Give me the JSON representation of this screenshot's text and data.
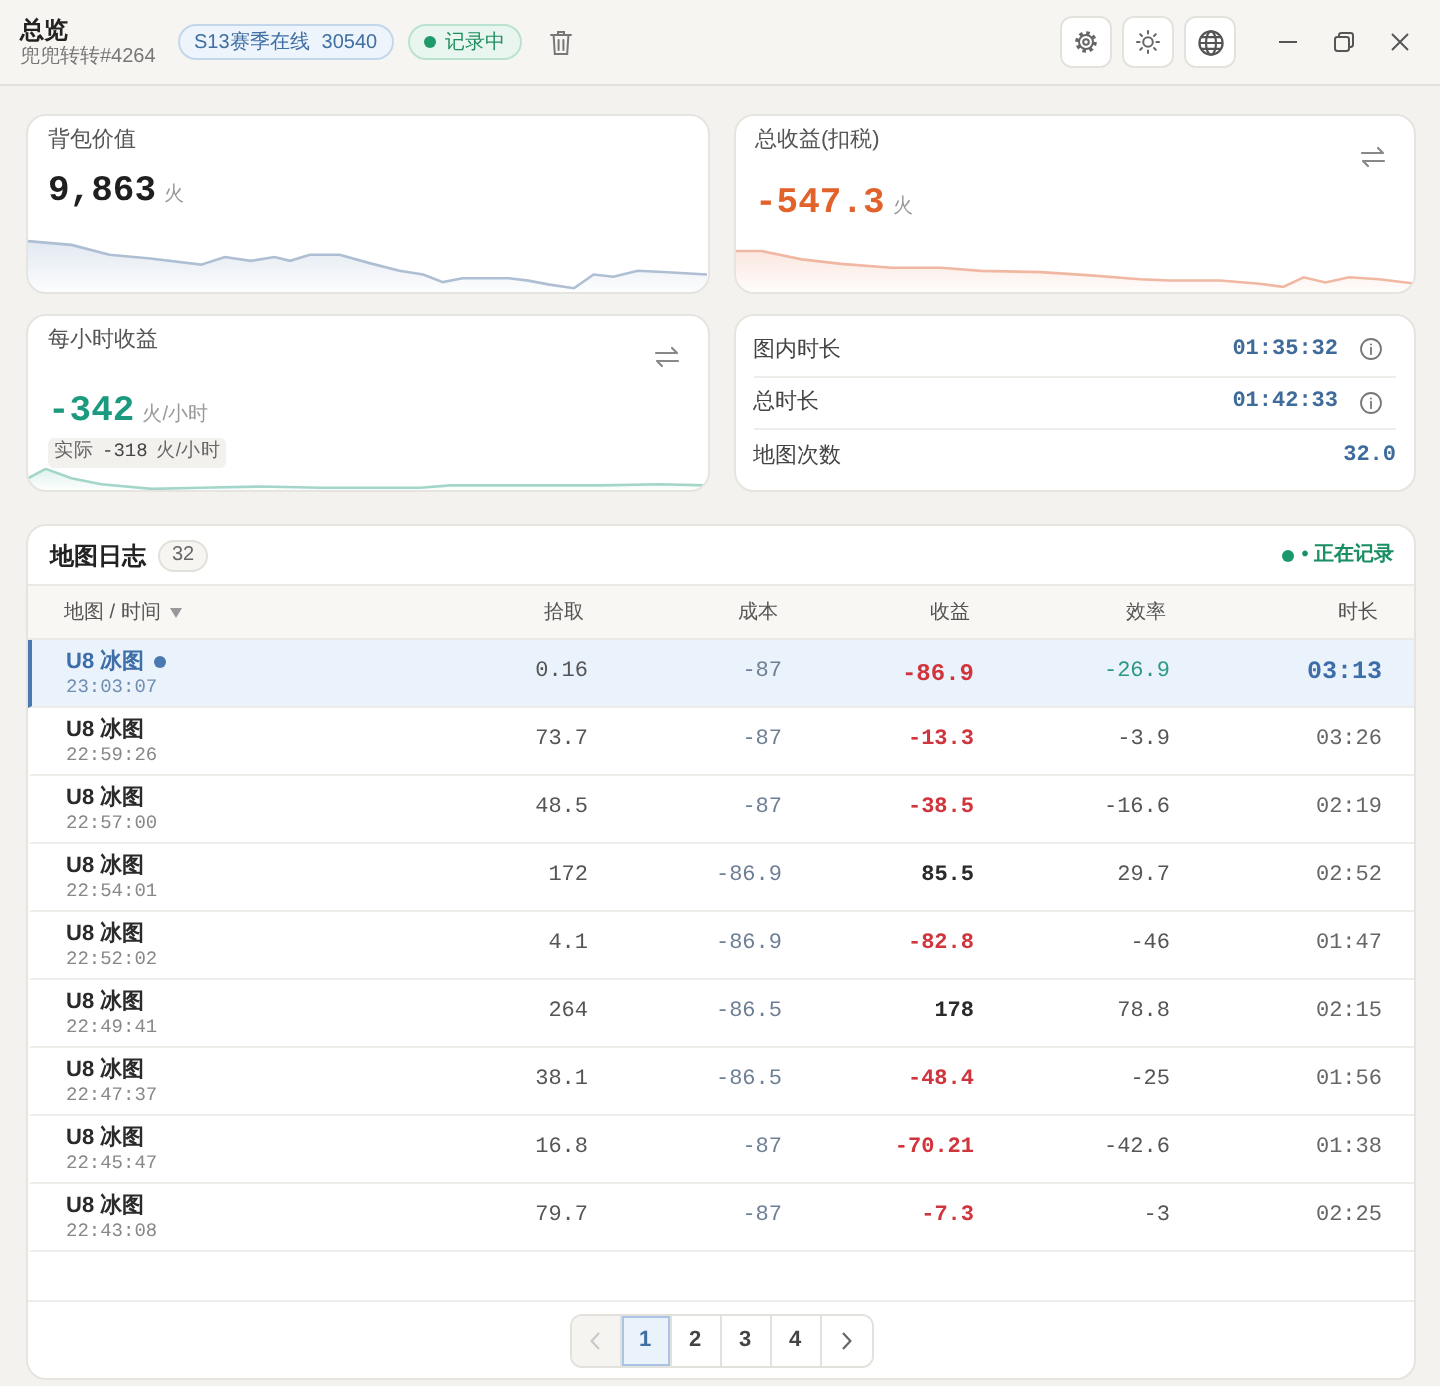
{
  "window": {
    "title": "总览",
    "subtitle": "兜兜转转#4264"
  },
  "season_badge": {
    "label": "S13赛季在线",
    "count": "30540"
  },
  "recording_badge": {
    "label": "记录中"
  },
  "stat_cards": [
    {
      "label": "背包价值",
      "value": "9,863",
      "unit": "火",
      "color": "#1f1f1f",
      "swap": false
    },
    {
      "label": "总收益(扣税)",
      "value": "-547.3",
      "unit": "火",
      "color": "#e2622c",
      "swap": true
    },
    {
      "label": "每小时收益",
      "value": "-342",
      "unit": "火/小时",
      "color": "#1b9a7f",
      "swap": true,
      "actual": {
        "label": "实际",
        "value": "-318",
        "unit": "火/小时"
      }
    }
  ],
  "durations": [
    {
      "label": "图内时长",
      "value": "01:35:32",
      "info": true
    },
    {
      "label": "总时长",
      "value": "01:42:33",
      "info": true
    },
    {
      "label": "地图次数",
      "value": "32.0",
      "info": false
    }
  ],
  "map_log": {
    "title": "地图日志",
    "count": "32",
    "status": "• 正在记录",
    "columns": [
      {
        "label": "地图 / 时间",
        "sorted": true
      },
      {
        "label": "拾取",
        "sorted": false
      },
      {
        "label": "成本",
        "sorted": false
      },
      {
        "label": "收益",
        "sorted": false
      },
      {
        "label": "效率",
        "sorted": false
      },
      {
        "label": "时长",
        "sorted": false
      }
    ],
    "rows": [
      {
        "map": "U8 冰图",
        "time": "23:03:07",
        "pickup": "0.16",
        "cost": "-87",
        "profit": "-86.9",
        "loss": true,
        "efficiency": "-26.9",
        "duration": "03:13",
        "selected": true,
        "live": true
      },
      {
        "map": "U8 冰图",
        "time": "22:59:26",
        "pickup": "73.7",
        "cost": "-87",
        "profit": "-13.3",
        "loss": true,
        "efficiency": "-3.9",
        "duration": "03:26",
        "selected": false,
        "live": false
      },
      {
        "map": "U8 冰图",
        "time": "22:57:00",
        "pickup": "48.5",
        "cost": "-87",
        "profit": "-38.5",
        "loss": true,
        "efficiency": "-16.6",
        "duration": "02:19",
        "selected": false,
        "live": false
      },
      {
        "map": "U8 冰图",
        "time": "22:54:01",
        "pickup": "172",
        "cost": "-86.9",
        "profit": "85.5",
        "loss": false,
        "efficiency": "29.7",
        "duration": "02:52",
        "selected": false,
        "live": false
      },
      {
        "map": "U8 冰图",
        "time": "22:52:02",
        "pickup": "4.1",
        "cost": "-86.9",
        "profit": "-82.8",
        "loss": true,
        "efficiency": "-46",
        "duration": "01:47",
        "selected": false,
        "live": false
      },
      {
        "map": "U8 冰图",
        "time": "22:49:41",
        "pickup": "264",
        "cost": "-86.5",
        "profit": "178",
        "loss": false,
        "efficiency": "78.8",
        "duration": "02:15",
        "selected": false,
        "live": false
      },
      {
        "map": "U8 冰图",
        "time": "22:47:37",
        "pickup": "38.1",
        "cost": "-86.5",
        "profit": "-48.4",
        "loss": true,
        "efficiency": "-25",
        "duration": "01:56",
        "selected": false,
        "live": false
      },
      {
        "map": "U8 冰图",
        "time": "22:45:47",
        "pickup": "16.8",
        "cost": "-87",
        "profit": "-70.21",
        "loss": true,
        "efficiency": "-42.6",
        "duration": "01:38",
        "selected": false,
        "live": false
      },
      {
        "map": "U8 冰图",
        "time": "22:43:08",
        "pickup": "79.7",
        "cost": "-87",
        "profit": "-7.3",
        "loss": true,
        "efficiency": "-3",
        "duration": "02:25",
        "selected": false,
        "live": false
      }
    ],
    "pagination": {
      "prev_disabled": true,
      "next_disabled": false,
      "pages": [
        {
          "label": "1",
          "selected": true
        },
        {
          "label": "2",
          "selected": false
        },
        {
          "label": "3",
          "selected": false
        },
        {
          "label": "4",
          "selected": false
        }
      ]
    }
  }
}
